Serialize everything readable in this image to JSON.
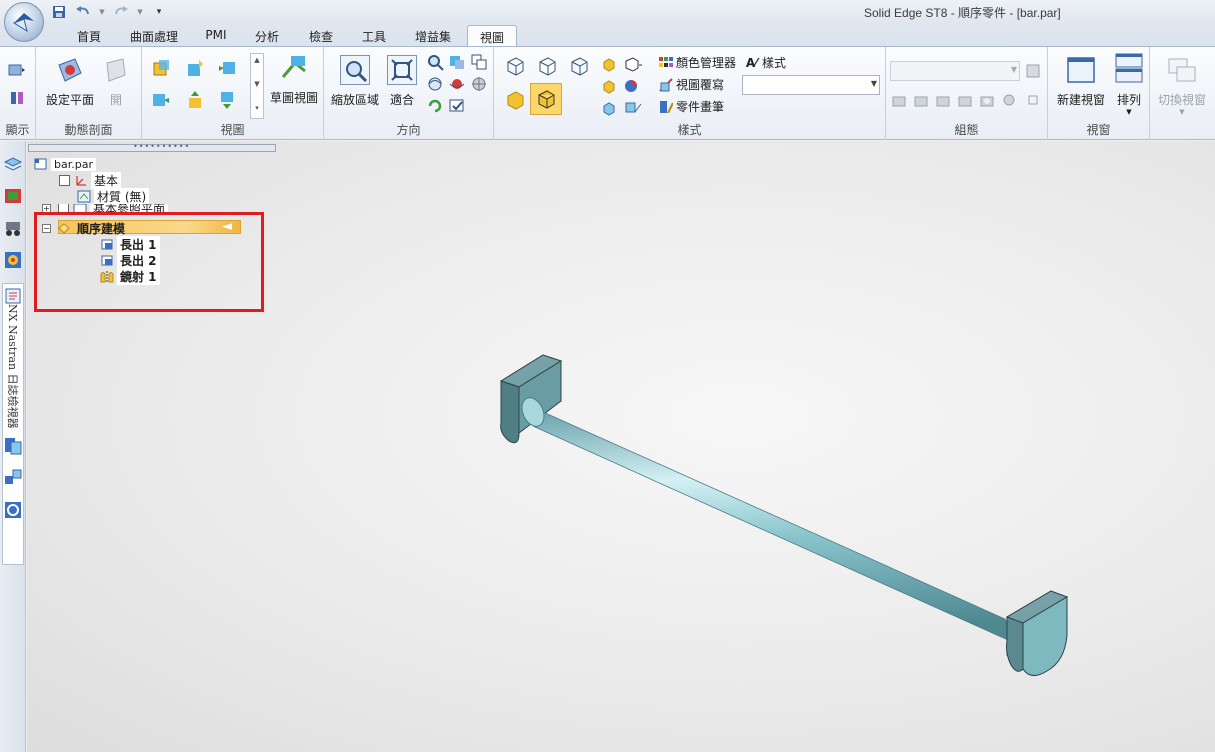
{
  "window": {
    "title": "Solid Edge ST8 - 順序零件 - [bar.par]"
  },
  "qat": {
    "save_icon": "save-icon",
    "undo_icon": "undo-icon",
    "redo_icon": "redo-icon"
  },
  "tabs": [
    {
      "label": "首頁"
    },
    {
      "label": "曲面處理"
    },
    {
      "label": "PMI"
    },
    {
      "label": "分析"
    },
    {
      "label": "檢查"
    },
    {
      "label": "工具"
    },
    {
      "label": "增益集"
    },
    {
      "label": "視圖"
    }
  ],
  "ribbon": {
    "groups": {
      "show": "顯示",
      "dynamic_section": "動態剖面",
      "views": "視圖",
      "orientation": "方向",
      "style": "樣式",
      "assembly": "組態",
      "window": "視窗"
    },
    "buttons": {
      "set_plane": "設定平面",
      "open": "開",
      "sketch_view": "草圖視圖",
      "zoom_area": "縮放區域",
      "fit": "適合",
      "color_manager": "顏色管理器",
      "view_overrides": "視圖覆寫",
      "part_painter": "零件畫筆",
      "styles": "樣式",
      "new_window": "新建視窗",
      "arrange": "排列",
      "switch_window": "切換視窗"
    }
  },
  "pathfinder": {
    "root": "bar.par",
    "base": "基本",
    "material": "材質 (無)",
    "base_planes": "基本參照平面",
    "ordered": "順序建模",
    "features": [
      {
        "label": "長出 1"
      },
      {
        "label": "長出 2"
      },
      {
        "label": "鏡射 1"
      }
    ]
  },
  "side_tab": {
    "label": "NX Nastran 日誌檢視器"
  },
  "colors": {
    "accent_red": "#e11b22",
    "model": "#8fc7cf",
    "highlight": "#f7c45d"
  }
}
